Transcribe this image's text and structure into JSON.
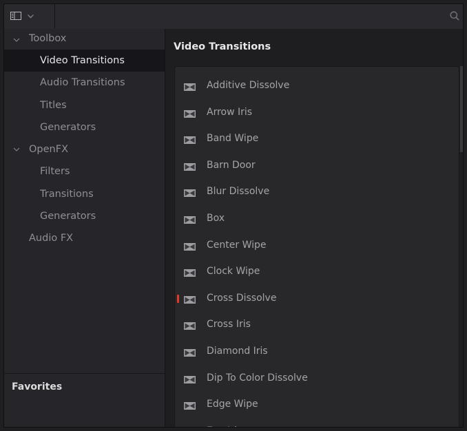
{
  "toolbar": {
    "panel_icon": "sidebar-panel-icon",
    "dropdown_icon": "chevron-down-icon",
    "search_icon": "search-icon"
  },
  "sidebar": {
    "items": [
      {
        "label": "Toolbox",
        "level": 0,
        "expanded": true
      },
      {
        "label": "Video Transitions",
        "level": 1,
        "selected": true
      },
      {
        "label": "Audio Transitions",
        "level": 1
      },
      {
        "label": "Titles",
        "level": 1
      },
      {
        "label": "Generators",
        "level": 1
      },
      {
        "label": "OpenFX",
        "level": 0,
        "expanded": true
      },
      {
        "label": "Filters",
        "level": 1
      },
      {
        "label": "Transitions",
        "level": 1
      },
      {
        "label": "Generators",
        "level": 1
      },
      {
        "label": "Audio FX",
        "level": 0
      }
    ],
    "favorites_label": "Favorites"
  },
  "main": {
    "title": "Video Transitions",
    "items": [
      {
        "label": "Additive Dissolve"
      },
      {
        "label": "Arrow Iris"
      },
      {
        "label": "Band Wipe"
      },
      {
        "label": "Barn Door"
      },
      {
        "label": "Blur Dissolve"
      },
      {
        "label": "Box"
      },
      {
        "label": "Center Wipe"
      },
      {
        "label": "Clock Wipe"
      },
      {
        "label": "Cross Dissolve",
        "marked": true
      },
      {
        "label": "Cross Iris"
      },
      {
        "label": "Diamond Iris"
      },
      {
        "label": "Dip To Color Dissolve"
      },
      {
        "label": "Edge Wipe"
      },
      {
        "label": "Eye Iris"
      }
    ]
  },
  "colors": {
    "background": "#1e1e21",
    "sidebar": "#26262a",
    "selected_row": "#16161a",
    "marker": "#e03a2c"
  }
}
